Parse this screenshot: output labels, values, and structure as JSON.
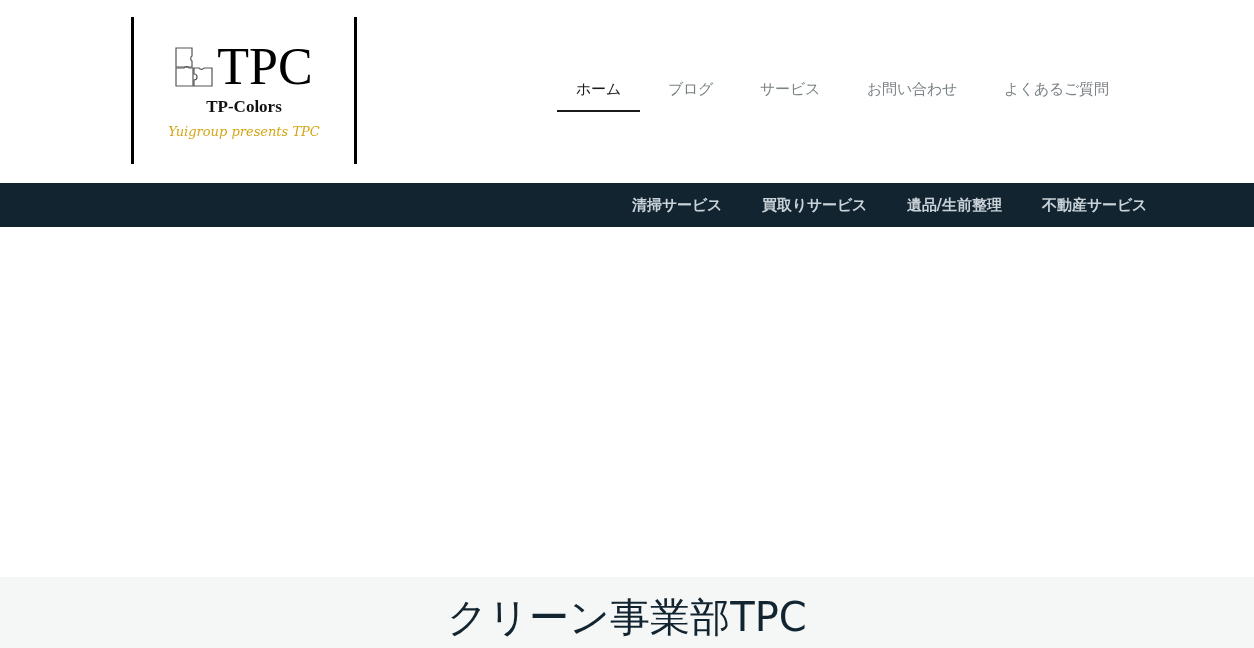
{
  "logo": {
    "title": "TPC",
    "subtitle": "TP-Colors",
    "tagline": "Yuigroup presents TPC"
  },
  "main_nav": [
    {
      "label": "ホーム",
      "selected": true
    },
    {
      "label": "ブログ",
      "selected": false
    },
    {
      "label": "サービス",
      "selected": false
    },
    {
      "label": "お問い合わせ",
      "selected": false
    },
    {
      "label": "よくあるご質問",
      "selected": false
    }
  ],
  "sub_nav": [
    "清掃サービス",
    "買取りサービス",
    "遺品/生前整理",
    "不動産サービス"
  ],
  "section": {
    "heading": "クリーン事業部TPC"
  }
}
